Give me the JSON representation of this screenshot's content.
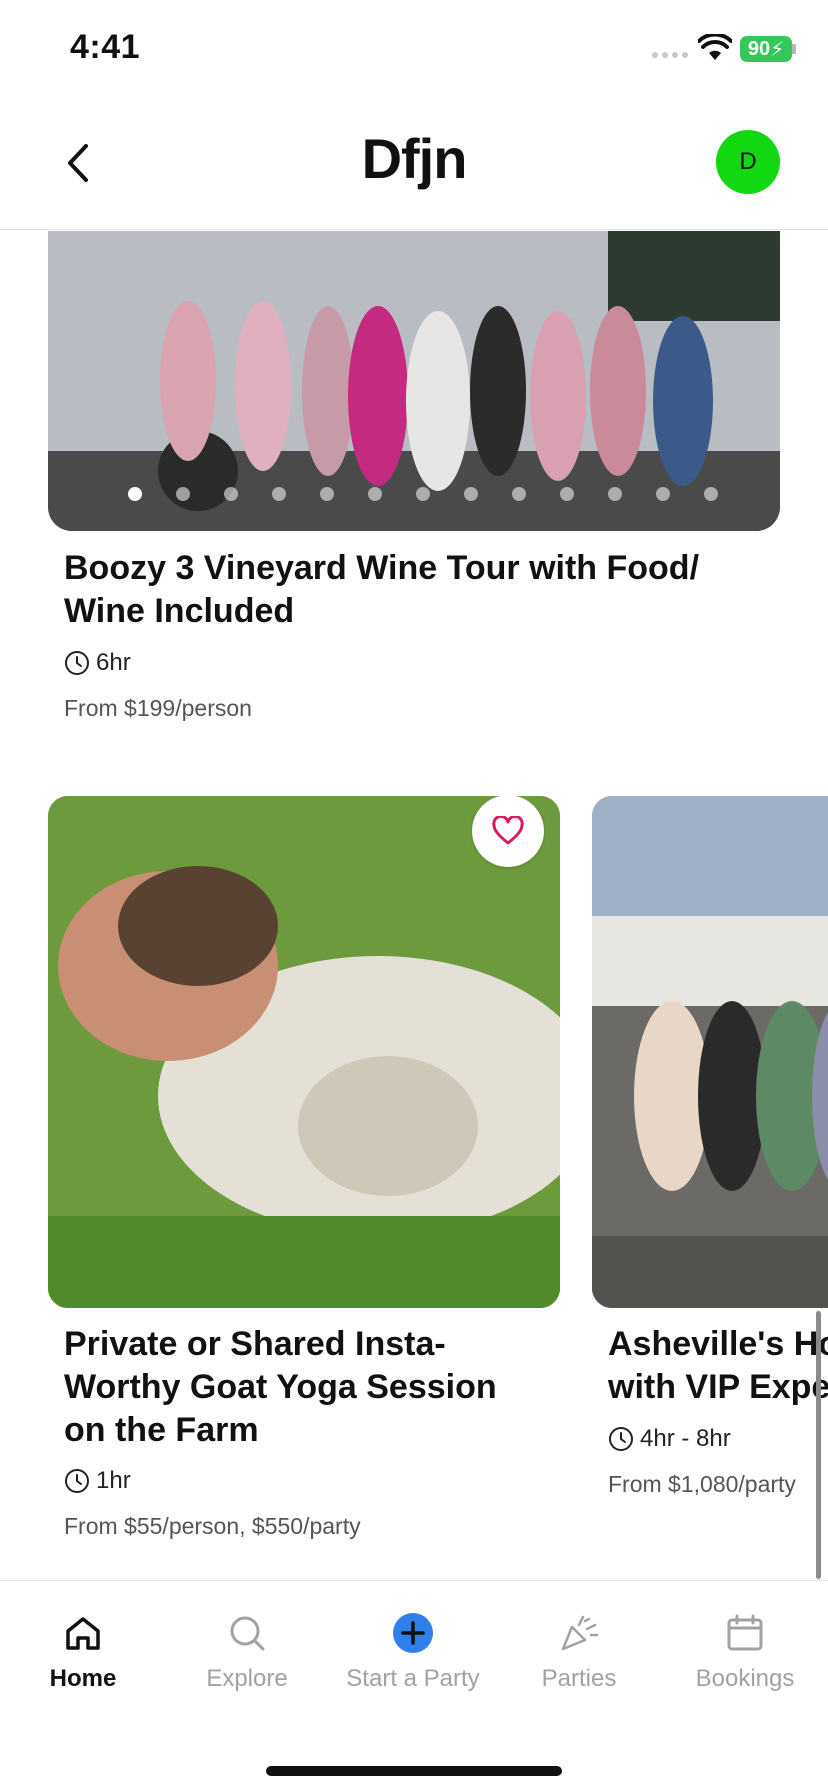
{
  "status_bar": {
    "time": "4:41",
    "battery": "90"
  },
  "header": {
    "title": "Dfjn",
    "avatar_initial": "D"
  },
  "colors": {
    "avatar": "#11d811",
    "favorite": "#d81b60",
    "start_party": "#2f80ed",
    "active_tab": "#111111",
    "inactive_tab": "#a2a2a2"
  },
  "cards": [
    {
      "title": "Boozy 3 Vineyard Wine Tour with Food/ Wine Included",
      "title_line1": "Boozy 3 Vineyard Wine Tour with Food/",
      "title_line2": "Wine Included",
      "duration": "6hr",
      "price": "From $199/person",
      "carousel_count": 13,
      "carousel_active": 1
    },
    {
      "title_line1": "Private or Shared Insta-",
      "title_line2": "Worthy Goat Yoga Session",
      "title_line3": "on the Farm",
      "duration": "1hr",
      "price": "From $55/person, $550/party",
      "favorite_icon": "heart-outline"
    },
    {
      "title_line1": "Asheville's Ho",
      "title_line2": "with VIP Expe",
      "duration": "4hr - 8hr",
      "price": "From $1,080/party"
    }
  ],
  "tabs": [
    {
      "label": "Home",
      "icon": "home-icon",
      "active": true
    },
    {
      "label": "Explore",
      "icon": "search-icon",
      "active": false
    },
    {
      "label": "Start a Party",
      "icon": "plus-circle-icon",
      "active": false
    },
    {
      "label": "Parties",
      "icon": "party-popper-icon",
      "active": false
    },
    {
      "label": "Bookings",
      "icon": "calendar-icon",
      "active": false
    }
  ]
}
